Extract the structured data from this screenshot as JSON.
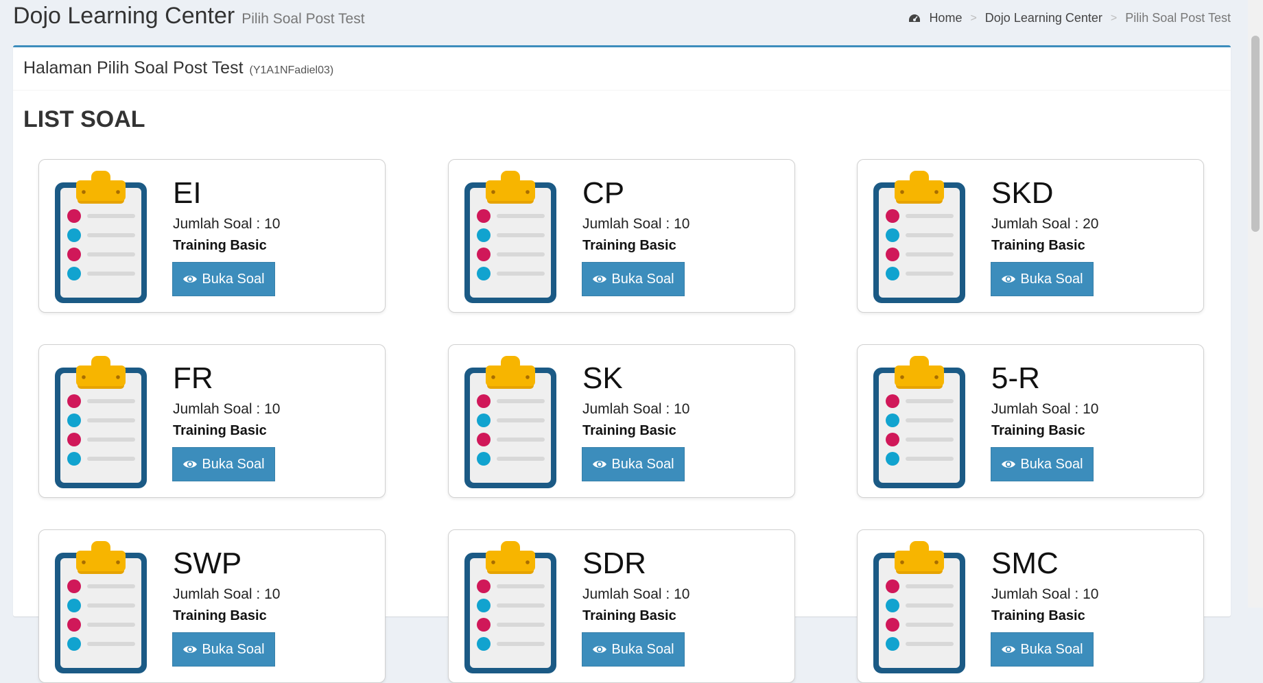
{
  "header": {
    "title": "Dojo Learning Center",
    "subtitle": "Pilih Soal Post Test"
  },
  "breadcrumb": {
    "home_icon": "dashboard-icon",
    "items": [
      "Home",
      "Dojo Learning Center",
      "Pilih Soal Post Test"
    ]
  },
  "panel": {
    "title": "Halaman Pilih Soal Post Test",
    "user_code": "(Y1A1NFadiel03)",
    "list_heading": "LIST SOAL"
  },
  "colors": {
    "accent": "#3c8dbc",
    "clipboard_frame": "#1b5a85",
    "clipboard_clip": "#f7b500",
    "dot_red": "#d01859",
    "dot_blue": "#11a3cf"
  },
  "cards": [
    {
      "code": "EI",
      "count": "Jumlah Soal : 10",
      "category": "Training Basic",
      "button": "Buka Soal"
    },
    {
      "code": "CP",
      "count": "Jumlah Soal : 10",
      "category": "Training Basic",
      "button": "Buka Soal"
    },
    {
      "code": "SKD",
      "count": "Jumlah Soal : 20",
      "category": "Training Basic",
      "button": "Buka Soal"
    },
    {
      "code": "FR",
      "count": "Jumlah Soal : 10",
      "category": "Training Basic",
      "button": "Buka Soal"
    },
    {
      "code": "SK",
      "count": "Jumlah Soal : 10",
      "category": "Training Basic",
      "button": "Buka Soal"
    },
    {
      "code": "5-R",
      "count": "Jumlah Soal : 10",
      "category": "Training Basic",
      "button": "Buka Soal"
    },
    {
      "code": "SWP",
      "count": "Jumlah Soal : 10",
      "category": "Training Basic",
      "button": "Buka Soal"
    },
    {
      "code": "SDR",
      "count": "Jumlah Soal : 10",
      "category": "Training Basic",
      "button": "Buka Soal"
    },
    {
      "code": "SMC",
      "count": "Jumlah Soal : 10",
      "category": "Training Basic",
      "button": "Buka Soal"
    }
  ]
}
